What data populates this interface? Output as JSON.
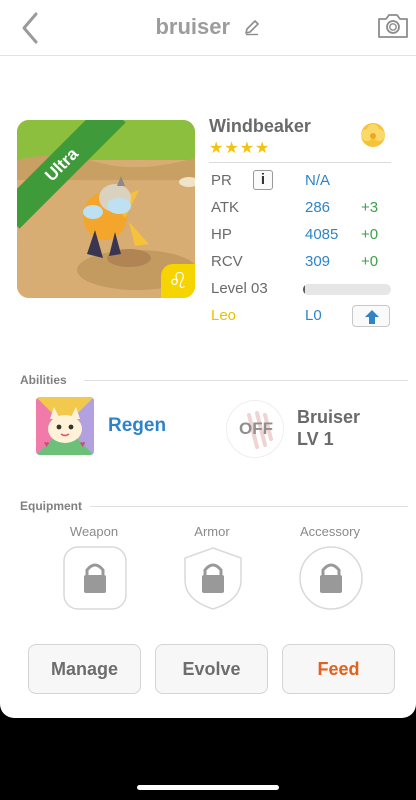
{
  "header": {
    "title": "bruiser"
  },
  "monster": {
    "name": "Windbeaker",
    "stars": "★★★★",
    "rarity_ribbon": "Ultra",
    "sign_glyph": "♌",
    "stats": {
      "pr": {
        "label": "PR",
        "info": "i",
        "value": "N/A"
      },
      "atk": {
        "label": "ATK",
        "value": "286",
        "bonus": "+3"
      },
      "hp": {
        "label": "HP",
        "value": "4085",
        "bonus": "+0"
      },
      "rcv": {
        "label": "RCV",
        "value": "309",
        "bonus": "+0"
      },
      "level": {
        "label": "Level 03",
        "progress_fraction": 0.02
      },
      "sign": {
        "label": "Leo",
        "value": "L0"
      }
    }
  },
  "abilities": {
    "section_label": "Abilities",
    "ability_name": "Regen",
    "skill_toggle": "OFF",
    "skill_name": "Bruiser",
    "skill_level": "LV 1"
  },
  "equipment": {
    "section_label": "Equipment",
    "slots": [
      {
        "label": "Weapon"
      },
      {
        "label": "Armor"
      },
      {
        "label": "Accessory"
      }
    ]
  },
  "actions": {
    "manage": "Manage",
    "evolve": "Evolve",
    "feed": "Feed"
  },
  "colors": {
    "accent_blue": "#2f84c9",
    "bonus_green": "#3aa247",
    "feed_orange": "#e2611d",
    "sign_yellow": "#e7c200"
  }
}
